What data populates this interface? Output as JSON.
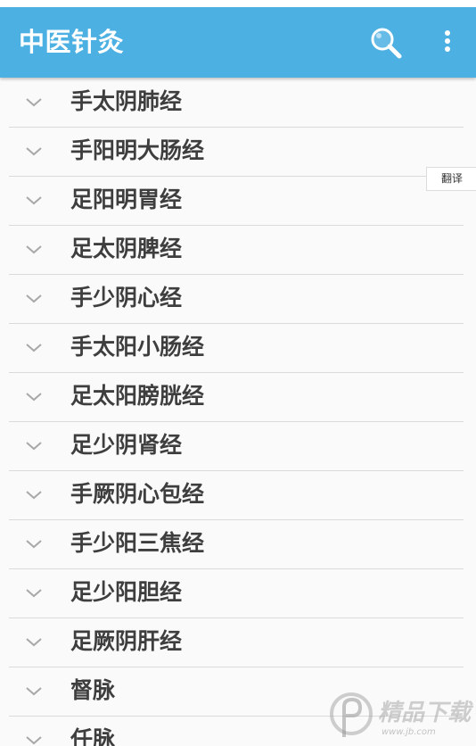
{
  "app_bar": {
    "title": "中医针灸",
    "background_color": "#4db0e3",
    "search_icon": "search-icon",
    "menu_icon": "more-vertical-icon"
  },
  "translate_label": "翻译",
  "meridian_list": {
    "expand_icon": "chevron-down-icon",
    "items": [
      {
        "label": "手太阴肺经"
      },
      {
        "label": "手阳明大肠经"
      },
      {
        "label": "足阳明胃经"
      },
      {
        "label": "足太阴脾经"
      },
      {
        "label": "手少阴心经"
      },
      {
        "label": "手太阳小肠经"
      },
      {
        "label": "足太阳膀胱经"
      },
      {
        "label": "足少阴肾经"
      },
      {
        "label": "手厥阴心包经"
      },
      {
        "label": "手少阳三焦经"
      },
      {
        "label": "足少阳胆经"
      },
      {
        "label": "足厥阴肝经"
      },
      {
        "label": "督脉"
      },
      {
        "label": "任脉"
      }
    ]
  },
  "watermark": {
    "text": "精品下载",
    "url_text": "www.jb.com"
  }
}
